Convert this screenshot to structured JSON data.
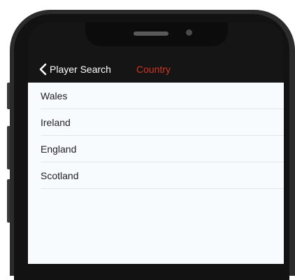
{
  "nav": {
    "back_label": "Player Search",
    "title": "Country",
    "title_color": "#d0351f"
  },
  "countries": [
    "Wales",
    "Ireland",
    "England",
    "Scotland"
  ]
}
